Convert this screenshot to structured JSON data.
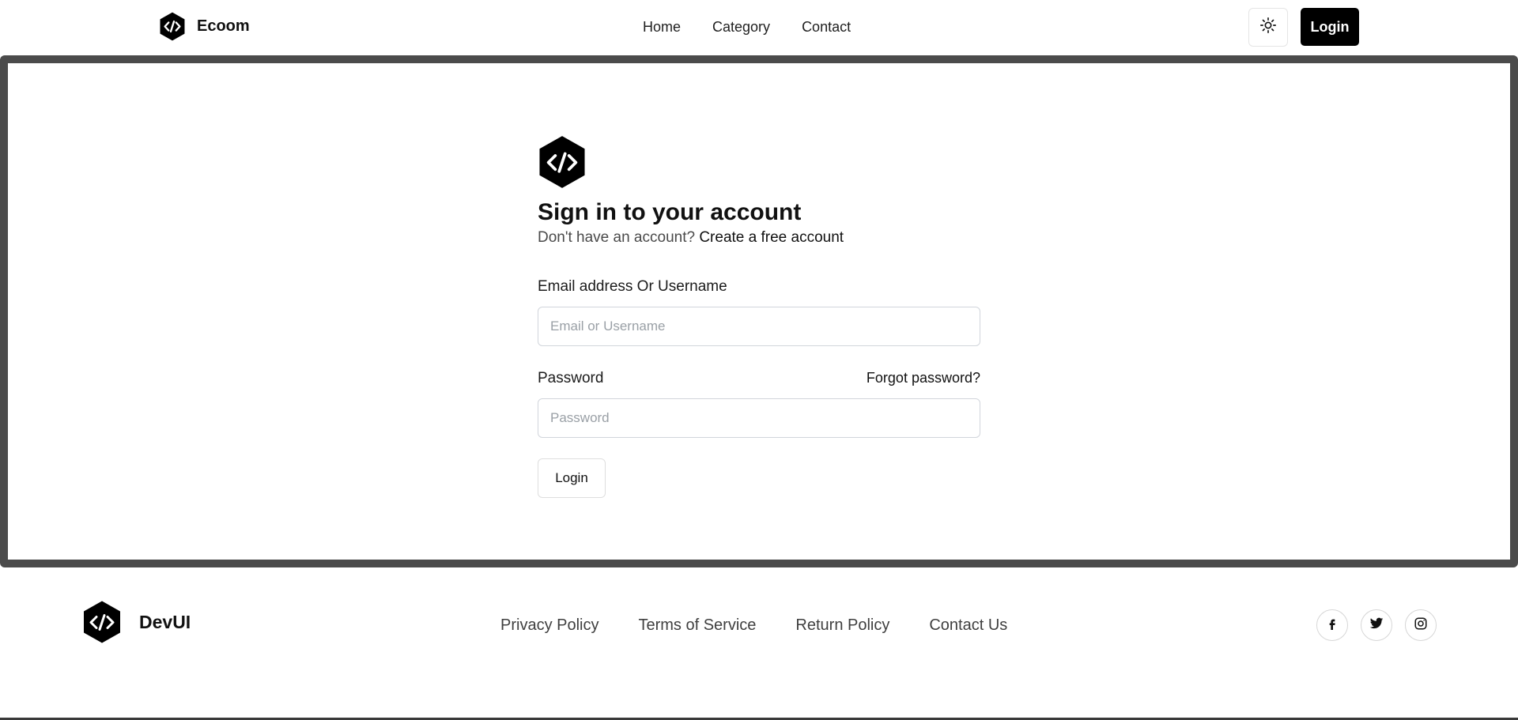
{
  "header": {
    "brand": "Ecoom",
    "nav": [
      "Home",
      "Category",
      "Contact"
    ],
    "theme_icon": "sun-icon",
    "login_label": "Login"
  },
  "signin": {
    "title": "Sign in to your account",
    "prompt": "Don't have an account?",
    "create_link": "Create a free account",
    "email_label": "Email address Or Username",
    "email_placeholder": "Email or Username",
    "email_value": "",
    "password_label": "Password",
    "forgot_label": "Forgot password?",
    "password_placeholder": "Password",
    "password_value": "",
    "submit_label": "Login"
  },
  "footer": {
    "brand": "DevUI",
    "links": [
      "Privacy Policy",
      "Terms of Service",
      "Return Policy",
      "Contact Us"
    ],
    "social_icons": [
      "facebook-icon",
      "twitter-icon",
      "instagram-icon"
    ]
  },
  "colors": {
    "primary": "#000000",
    "frame_border": "#4b4b4b",
    "text_muted": "#4a4a4a",
    "footer_link": "#3f3f3f"
  }
}
